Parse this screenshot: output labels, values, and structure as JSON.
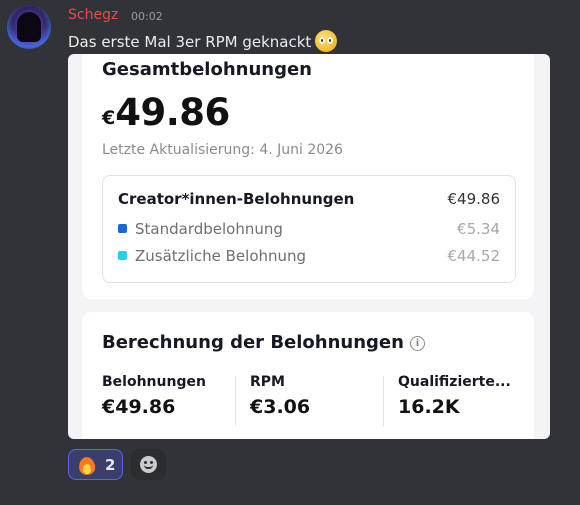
{
  "message": {
    "username": "Schegz",
    "timestamp": "00:02",
    "text": "Das erste Mal 3er RPM geknackt",
    "emoji": "pleading-face",
    "username_color": "#f04747"
  },
  "embed": {
    "card1": {
      "title": "Gesamtbelohnungen",
      "currency": "€",
      "amount": "49.86",
      "updated": "Letzte Aktualisierung: 4. Juni 2026",
      "breakdown": {
        "head_label": "Creator*innen-Belohnungen",
        "head_value": "€49.86",
        "items": [
          {
            "label": "Standardbelohnung",
            "value": "€5.34",
            "color": "#1769d9"
          },
          {
            "label": "Zusätzliche Belohnung",
            "value": "€44.52",
            "color": "#22d3e6"
          }
        ]
      }
    },
    "card2": {
      "title": "Berechnung der Belohnungen",
      "info_icon": "info-icon",
      "stats": [
        {
          "label": "Belohnungen",
          "value": "€49.86"
        },
        {
          "label": "RPM",
          "value": "€3.06"
        },
        {
          "label": "Qualifizierte...",
          "value": "16.2K"
        }
      ]
    }
  },
  "reactions": {
    "fire": {
      "emoji": "fire",
      "count": "2"
    },
    "add_reaction_icon": "smile-plus-icon"
  },
  "colors": {
    "background": "#323339",
    "reaction_active_border": "#5865f2"
  }
}
